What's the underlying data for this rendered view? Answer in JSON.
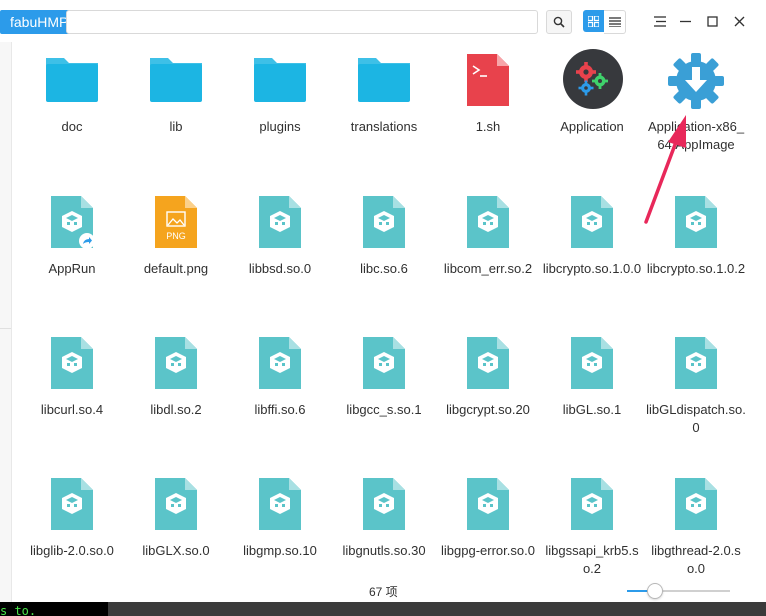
{
  "window": {
    "breadcrumb": "fabuHMP",
    "address_value": "",
    "view_mode": "grid"
  },
  "colors": {
    "accent": "#2c9bea",
    "folder": "#1cb5e3",
    "lib_file": "#5bc4c9",
    "script_file": "#e8424c",
    "image_file": "#f5a41e",
    "annotation_arrow": "#e8285a",
    "terminal_text": "#4ae24a"
  },
  "files": [
    {
      "name": "doc",
      "icon": "folder-icon"
    },
    {
      "name": "lib",
      "icon": "folder-icon"
    },
    {
      "name": "plugins",
      "icon": "folder-icon"
    },
    {
      "name": "translations",
      "icon": "folder-icon"
    },
    {
      "name": "1.sh",
      "icon": "shell-script-icon"
    },
    {
      "name": "Application",
      "icon": "application-gears-icon"
    },
    {
      "name": "Application-x86_64.AppImage",
      "icon": "appimage-icon"
    },
    {
      "name": "AppRun",
      "icon": "library-file-symlink-icon"
    },
    {
      "name": "default.png",
      "icon": "png-image-icon"
    },
    {
      "name": "libbsd.so.0",
      "icon": "library-file-icon"
    },
    {
      "name": "libc.so.6",
      "icon": "library-file-icon"
    },
    {
      "name": "libcom_err.so.2",
      "icon": "library-file-icon"
    },
    {
      "name": "libcrypto.so.1.0.0",
      "icon": "library-file-icon"
    },
    {
      "name": "libcrypto.so.1.0.2",
      "icon": "library-file-icon"
    },
    {
      "name": "libcurl.so.4",
      "icon": "library-file-icon"
    },
    {
      "name": "libdl.so.2",
      "icon": "library-file-icon"
    },
    {
      "name": "libffi.so.6",
      "icon": "library-file-icon"
    },
    {
      "name": "libgcc_s.so.1",
      "icon": "library-file-icon"
    },
    {
      "name": "libgcrypt.so.20",
      "icon": "library-file-icon"
    },
    {
      "name": "libGL.so.1",
      "icon": "library-file-icon"
    },
    {
      "name": "libGLdispatch.so.0",
      "icon": "library-file-icon"
    },
    {
      "name": "libglib-2.0.so.0",
      "icon": "library-file-icon"
    },
    {
      "name": "libGLX.so.0",
      "icon": "library-file-icon"
    },
    {
      "name": "libgmp.so.10",
      "icon": "library-file-icon"
    },
    {
      "name": "libgnutls.so.30",
      "icon": "library-file-icon"
    },
    {
      "name": "libgpg-error.so.0",
      "icon": "library-file-icon"
    },
    {
      "name": "libgssapi_krb5.so.2",
      "icon": "library-file-icon"
    },
    {
      "name": "libgthread-2.0.so.0",
      "icon": "library-file-icon"
    }
  ],
  "status": {
    "item_count": "67 项",
    "zoom_fraction": 0.26
  },
  "png_badge": "PNG",
  "terminal": {
    "text": "s to."
  }
}
